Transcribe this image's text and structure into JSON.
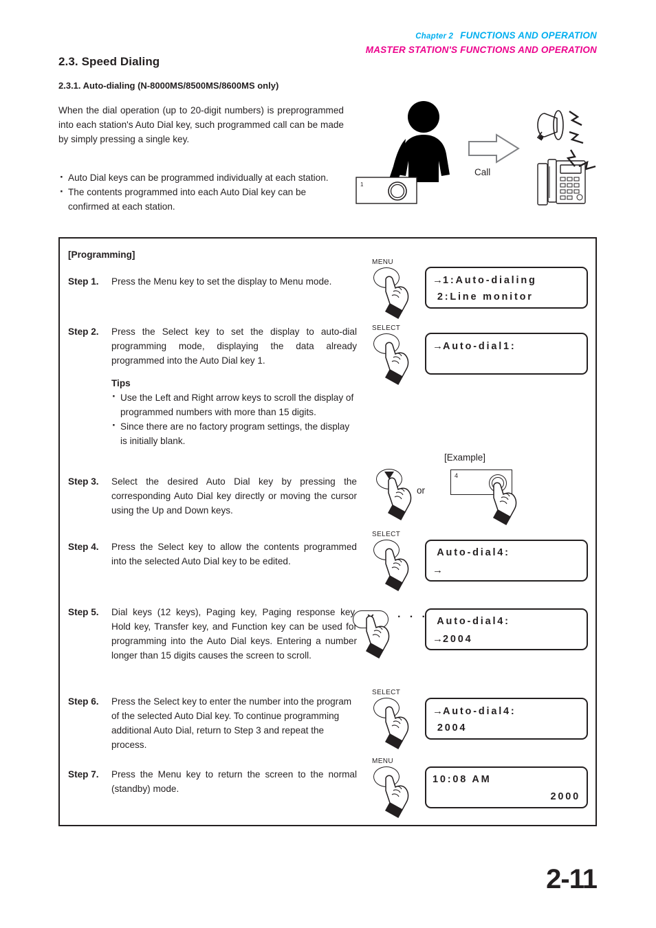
{
  "header": {
    "chapter": "Chapter 2",
    "chapter_title": "FUNCTIONS AND OPERATION",
    "station_line": "MASTER STATION'S FUNCTIONS AND OPERATION",
    "chapter_color": "#00aeef",
    "station_color": "#ec008c"
  },
  "section": {
    "title": "2.3. Speed Dialing",
    "subsection_title": "2.3.1. Auto-dialing (N-8000MS/8500MS/8600MS only)",
    "intro": "When the dial operation (up to 20-digit numbers) is preprogrammed into each station's Auto Dial key, such programmed call can be made by simply pressing a single key.",
    "bullets": [
      "Auto Dial keys can be programmed individually at each station.",
      "The contents programmed into each Auto Dial key can be confirmed at each station."
    ]
  },
  "illustration": {
    "call_label": "Call",
    "station_key_number": "1",
    "person_icon": "person-icon",
    "arrow_icon": "right-arrow-icon",
    "speaker_icon": "horn-speaker-icon",
    "telephone_icon": "desk-telephone-icon"
  },
  "programming": {
    "label": "[Programming]",
    "example_label": "[Example]",
    "or_label": "or",
    "dots": "· · ·",
    "example_key_number": "4",
    "steps": [
      {
        "label": "Step 1.",
        "text": "Press the Menu key to set the display to Menu mode."
      },
      {
        "label": "Step 2.",
        "text": "Press the Select key to set the display to auto-dial programming mode, displaying the data already programmed into the Auto Dial key 1.",
        "tips_heading": "Tips",
        "tips": [
          "Use the Left and Right arrow keys to scroll the display of programmed numbers with more than 15 digits.",
          "Since there are no factory program settings, the display is initially blank."
        ]
      },
      {
        "label": "Step 3.",
        "text": "Select the desired Auto Dial key by pressing the corresponding Auto Dial key directly or moving the cursor using the Up and Down keys."
      },
      {
        "label": "Step 4.",
        "text": "Press the Select key to allow the contents programmed into the selected Auto Dial key to be edited."
      },
      {
        "label": "Step 5.",
        "text": "Dial keys (12 keys), Paging key, Paging response key, Hold key, Transfer key, and Function key can be used for programming into the Auto Dial keys. Entering a number longer than 15 digits causes the screen to scroll."
      },
      {
        "label": "Step 6.",
        "text": "Press the Select key to enter the number into the program of the selected Auto Dial key. To continue programming additional Auto Dial, return to Step 3 and repeat the process."
      },
      {
        "label": "Step 7.",
        "text": "Press the Menu key to return the screen to the normal (standby) mode."
      }
    ],
    "keys": {
      "menu": "MENU",
      "select": "SELECT",
      "dial": "X"
    },
    "displays": [
      {
        "line1_arrow": "→",
        "line1": "1:Auto-dialing",
        "line2_arrow": "",
        "line2": " 2:Line monitor"
      },
      {
        "line1_arrow": "→",
        "line1": "Auto-dial1:",
        "line2_arrow": "",
        "line2": ""
      },
      {
        "line1_arrow": "",
        "line1": " Auto-dial4:",
        "line2_arrow": "→",
        "line2": ""
      },
      {
        "line1_arrow": "",
        "line1": " Auto-dial4:",
        "line2_arrow": "→",
        "line2": "2004"
      },
      {
        "line1_arrow": "→",
        "line1": "Auto-dial4:",
        "line2_arrow": "",
        "line2": " 2004"
      },
      {
        "line1_arrow": "",
        "line1": "10:08 AM",
        "line2_arrow": "",
        "line2": "2000"
      }
    ]
  },
  "footer": {
    "page_number": "2-11"
  }
}
